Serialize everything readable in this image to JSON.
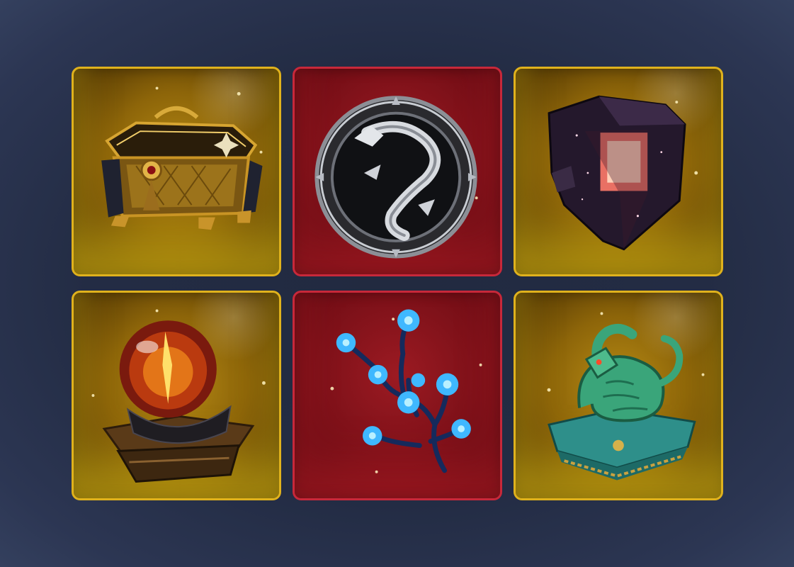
{
  "colors": {
    "background": "#232c44",
    "gold_border": "#e0b21c",
    "red_border": "#c8283a"
  },
  "grid": {
    "items": [
      {
        "icon": "treasure-chest-icon",
        "rarity": "gold"
      },
      {
        "icon": "dragon-emblem-coin-icon",
        "rarity": "red"
      },
      {
        "icon": "dark-crystal-block-icon",
        "rarity": "gold"
      },
      {
        "icon": "fire-orb-on-stand-icon",
        "rarity": "gold"
      },
      {
        "icon": "blue-flame-tree-icon",
        "rarity": "red"
      },
      {
        "icon": "jade-dragon-statue-icon",
        "rarity": "gold"
      }
    ]
  }
}
